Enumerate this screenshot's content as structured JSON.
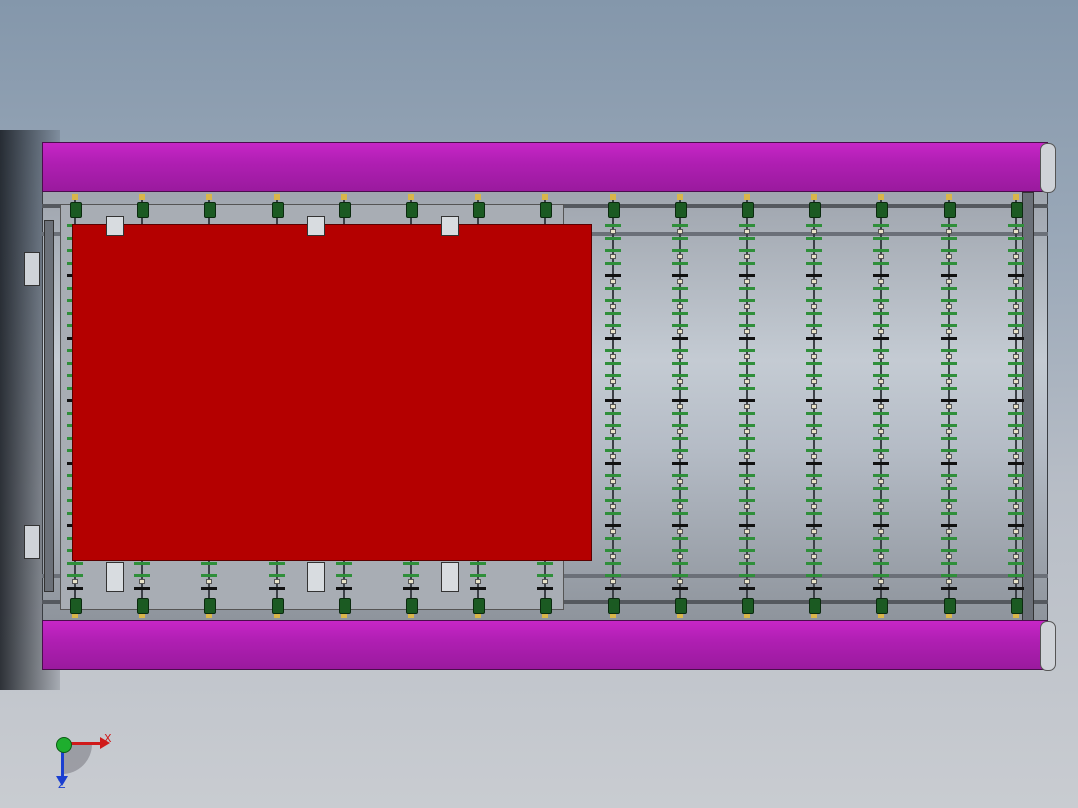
{
  "scene": {
    "colors": {
      "rail": "#b01fb3",
      "panel": "#b40000",
      "roller_cap": "#1b5a22",
      "roller_ring": "#2f8f3a",
      "background_top": "#8497ab",
      "background_bottom": "#c9ccd1"
    },
    "roller_columns": 15,
    "clamp_stations": 3
  },
  "triad": {
    "x_label": "X",
    "z_label": "Z",
    "icon": "axis-triad-icon"
  }
}
